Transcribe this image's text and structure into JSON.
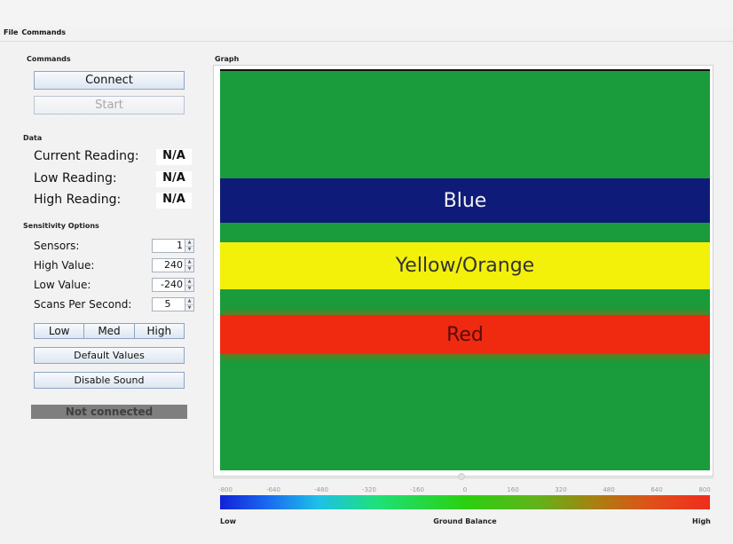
{
  "menu": {
    "file": "File",
    "commands": "Commands"
  },
  "commands": {
    "title": "Commands",
    "connect": "Connect",
    "start": "Start"
  },
  "data": {
    "title": "Data",
    "current_label": "Current Reading:",
    "current_value": "N/A",
    "low_label": "Low Reading:",
    "low_value": "N/A",
    "high_label": "High Reading:",
    "high_value": "N/A"
  },
  "sensitivity": {
    "title": "Sensitivity Options",
    "sensors_label": "Sensors:",
    "sensors_value": "1",
    "high_label": "High Value:",
    "high_value": "240",
    "low_label": "Low Value:",
    "low_value": "-240",
    "scans_label": "Scans Per Second:",
    "scans_value": "5",
    "preset_low": "Low",
    "preset_med": "Med",
    "preset_high": "High",
    "default_values": "Default Values",
    "disable_sound": "Disable Sound"
  },
  "status": "Not connected",
  "graph": {
    "title": "Graph",
    "bands": {
      "blue": "Blue",
      "yellow": "Yellow/Orange",
      "red": "Red"
    },
    "scale_ticks": [
      "-800",
      "-640",
      "-480",
      "-320",
      "-160",
      "0",
      "160",
      "320",
      "480",
      "640",
      "800"
    ],
    "bar_low": "Low",
    "bar_mid": "Ground Balance",
    "bar_high": "High"
  },
  "colors": {
    "background": "#1a9c3c",
    "blue_band": "#0f1b78",
    "yellow_band": "#f3f00a",
    "red_band": "#ef2a10"
  }
}
